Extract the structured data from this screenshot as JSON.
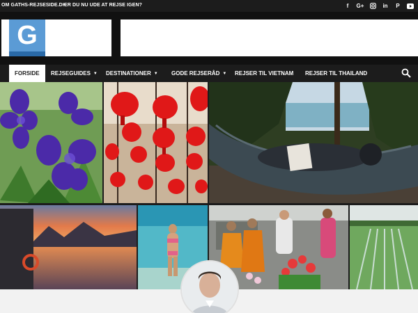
{
  "topbar": {
    "links": [
      "OM GATHS-REJSESIDE.DK",
      "ER DU NU UDE AT REJSE IGEN?"
    ],
    "social_icons": [
      "facebook-icon",
      "google-plus-icon",
      "instagram-icon",
      "linkedin-icon",
      "pinterest-icon",
      "youtube-icon"
    ]
  },
  "logo": {
    "letter": "G"
  },
  "nav": {
    "items": [
      {
        "label": "FORSIDE",
        "dropdown": false,
        "active": true
      },
      {
        "label": "REJSEGUIDES",
        "dropdown": true,
        "active": false
      },
      {
        "label": "DESTINATIONER",
        "dropdown": true,
        "active": false
      },
      {
        "label": "GODE REJSERÅD",
        "dropdown": true,
        "active": false
      },
      {
        "label": "REJSER TIL VIETNAM",
        "dropdown": false,
        "active": false
      },
      {
        "label": "REJSER TIL THAILAND",
        "dropdown": false,
        "active": false
      }
    ],
    "search_icon": "search-icon"
  },
  "colors": {
    "dark": "#1c1c1c",
    "accent_blue": "#5b9bd5",
    "white": "#ffffff"
  }
}
